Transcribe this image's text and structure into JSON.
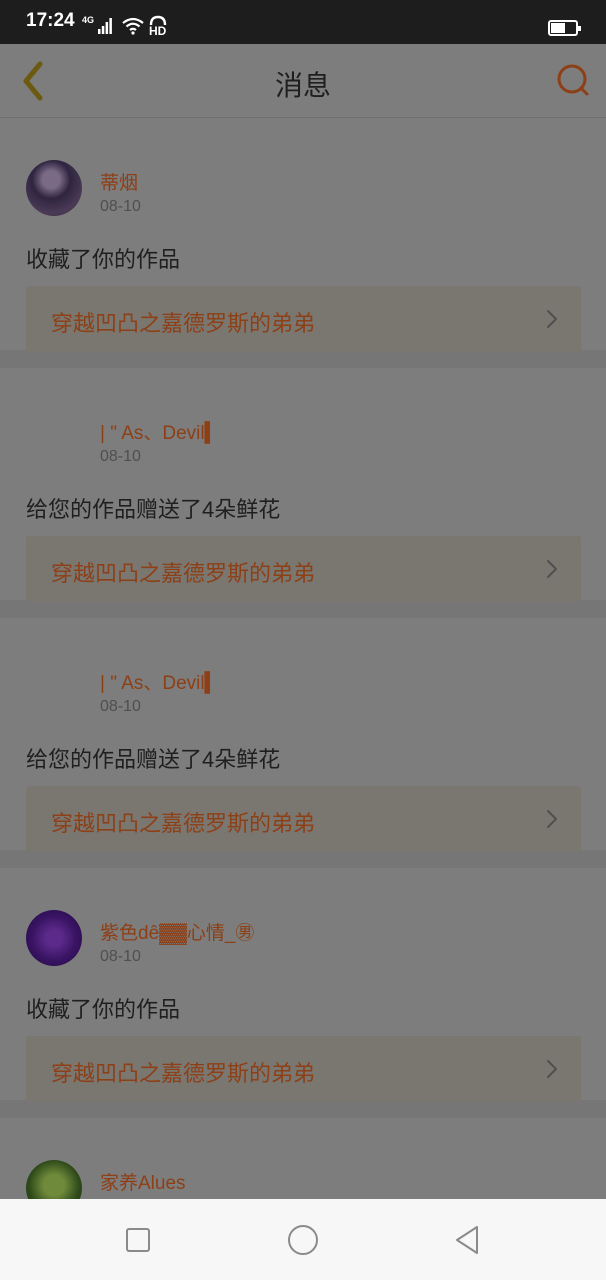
{
  "status_bar": {
    "time": "17:24",
    "network": "4G",
    "hd": "HD",
    "battery_level": 0.6
  },
  "header": {
    "title": "消息",
    "back_icon": "chevron-left-icon",
    "search_icon": "search-icon",
    "accent_color": "#c8671f"
  },
  "messages": [
    {
      "user": "蒂烟",
      "date": "08-10",
      "action": "收藏了你的作品",
      "work_title": "穿越凹凸之嘉德罗斯的弟弟"
    },
    {
      "user": "| \" As、Devil▍",
      "date": "08-10",
      "action": "给您的作品赠送了4朵鲜花",
      "work_title": "穿越凹凸之嘉德罗斯的弟弟"
    },
    {
      "user": "| \" As、Devil▍",
      "date": "08-10",
      "action": "给您的作品赠送了4朵鲜花",
      "work_title": "穿越凹凸之嘉德罗斯的弟弟"
    },
    {
      "user": "紫色dê▓▓心情_㊚",
      "date": "08-10",
      "action": "收藏了你的作品",
      "work_title": "穿越凹凸之嘉德罗斯的弟弟"
    },
    {
      "user": "家养Alues"
    }
  ],
  "system_nav": {
    "recents_icon": "square-icon",
    "home_icon": "circle-icon",
    "back_icon": "triangle-back-icon"
  }
}
